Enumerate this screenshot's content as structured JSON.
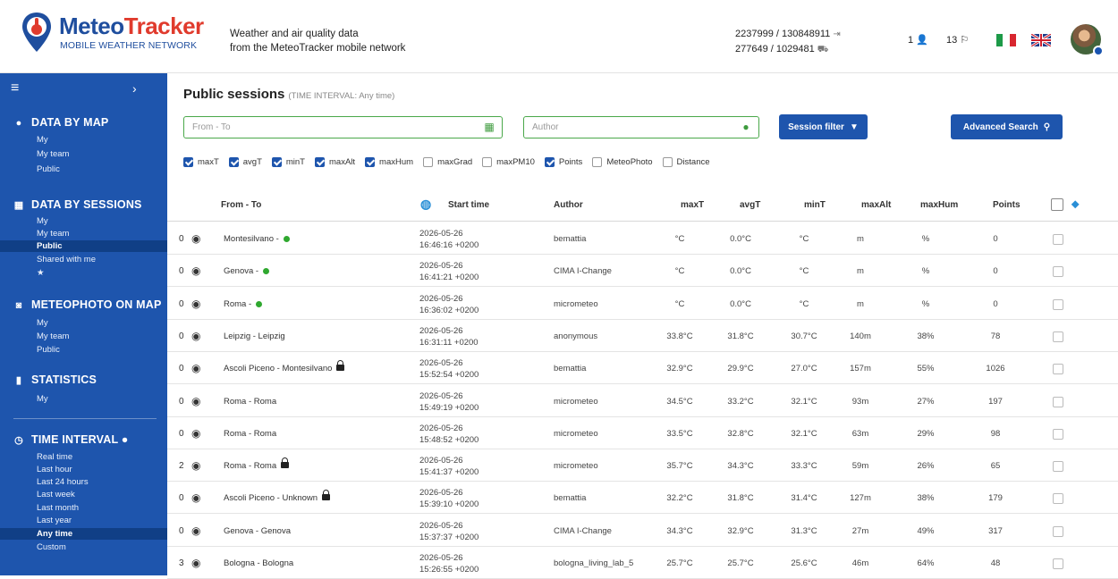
{
  "header": {
    "logo_title_a": "Meteo",
    "logo_title_b": "Tracker",
    "logo_subtitle": "MOBILE WEATHER NETWORK",
    "tagline_line1": "Weather and air quality data",
    "tagline_line2": "from the MeteoTracker mobile network",
    "stat_line1": "2237999 / 130848911",
    "stat_line2": "277649 / 1029481",
    "users_count": "1",
    "sessions_count": "13",
    "brand_color": "#1f4e9e",
    "accent_color": "#e03b2d"
  },
  "sidebar": {
    "background": "#1e55ad",
    "sections": {
      "data_by_map": "DATA BY MAP",
      "data_by_sessions": "DATA BY SESSIONS",
      "meteophoto_on_map": "METEOPHOTO ON MAP",
      "statistics": "STATISTICS",
      "time_interval": "TIME INTERVAL"
    },
    "map_items": [
      "My",
      "My team",
      "Public"
    ],
    "session_items": [
      "My",
      "My team",
      "Public",
      "Shared with me",
      "★"
    ],
    "photo_items": [
      "My",
      "My team",
      "Public"
    ],
    "stats_items": [
      "My"
    ],
    "time_items": [
      "Real time",
      "Last hour",
      "Last 24 hours",
      "Last week",
      "Last month",
      "Last year",
      "Any time",
      "Custom"
    ]
  },
  "main": {
    "title": "Public sessions",
    "subtitle": "(TIME INTERVAL: Any time)",
    "from_to_placeholder": "From - To",
    "author_placeholder": "Author",
    "session_filter_label": "Session filter",
    "advanced_search_label": "Advanced Search",
    "checkboxes": [
      {
        "label": "maxT",
        "checked": true
      },
      {
        "label": "avgT",
        "checked": true
      },
      {
        "label": "minT",
        "checked": true
      },
      {
        "label": "maxAlt",
        "checked": true
      },
      {
        "label": "maxHum",
        "checked": true
      },
      {
        "label": "maxGrad",
        "checked": false
      },
      {
        "label": "maxPM10",
        "checked": false
      },
      {
        "label": "Points",
        "checked": true
      },
      {
        "label": "MeteoPhoto",
        "checked": false
      },
      {
        "label": "Distance",
        "checked": false
      }
    ]
  },
  "table": {
    "headers": {
      "from_to": "From - To",
      "start_time": "Start time",
      "author": "Author",
      "maxT": "maxT",
      "avgT": "avgT",
      "minT": "minT",
      "maxAlt": "maxAlt",
      "maxHum": "maxHum",
      "points": "Points"
    },
    "rows": [
      {
        "count": "0",
        "from_to": "Montesilvano -",
        "live": true,
        "locked": false,
        "date": "2026-05-26",
        "time": "16:46:16 +0200",
        "author": "bemattia",
        "maxT": "°C",
        "avgT": "0.0°C",
        "minT": "°C",
        "maxAlt": "m",
        "maxHum": "%",
        "points": "0"
      },
      {
        "count": "0",
        "from_to": "Genova -",
        "live": true,
        "locked": false,
        "date": "2026-05-26",
        "time": "16:41:21 +0200",
        "author": "CIMA I-Change",
        "maxT": "°C",
        "avgT": "0.0°C",
        "minT": "°C",
        "maxAlt": "m",
        "maxHum": "%",
        "points": "0"
      },
      {
        "count": "0",
        "from_to": "Roma -",
        "live": true,
        "locked": false,
        "date": "2026-05-26",
        "time": "16:36:02 +0200",
        "author": "micrometeo",
        "maxT": "°C",
        "avgT": "0.0°C",
        "minT": "°C",
        "maxAlt": "m",
        "maxHum": "%",
        "points": "0"
      },
      {
        "count": "0",
        "from_to": "Leipzig - Leipzig",
        "live": false,
        "locked": false,
        "date": "2026-05-26",
        "time": "16:31:11 +0200",
        "author": "anonymous",
        "maxT": "33.8°C",
        "avgT": "31.8°C",
        "minT": "30.7°C",
        "maxAlt": "140m",
        "maxHum": "38%",
        "points": "78"
      },
      {
        "count": "0",
        "from_to": "Ascoli Piceno - Montesilvano",
        "live": false,
        "locked": true,
        "date": "2026-05-26",
        "time": "15:52:54 +0200",
        "author": "bemattia",
        "maxT": "32.9°C",
        "avgT": "29.9°C",
        "minT": "27.0°C",
        "maxAlt": "157m",
        "maxHum": "55%",
        "points": "1026"
      },
      {
        "count": "0",
        "from_to": "Roma - Roma",
        "live": false,
        "locked": false,
        "date": "2026-05-26",
        "time": "15:49:19 +0200",
        "author": "micrometeo",
        "maxT": "34.5°C",
        "avgT": "33.2°C",
        "minT": "32.1°C",
        "maxAlt": "93m",
        "maxHum": "27%",
        "points": "197"
      },
      {
        "count": "0",
        "from_to": "Roma - Roma",
        "live": false,
        "locked": false,
        "date": "2026-05-26",
        "time": "15:48:52 +0200",
        "author": "micrometeo",
        "maxT": "33.5°C",
        "avgT": "32.8°C",
        "minT": "32.1°C",
        "maxAlt": "63m",
        "maxHum": "29%",
        "points": "98"
      },
      {
        "count": "2",
        "from_to": "Roma - Roma",
        "live": false,
        "locked": true,
        "date": "2026-05-26",
        "time": "15:41:37 +0200",
        "author": "micrometeo",
        "maxT": "35.7°C",
        "avgT": "34.3°C",
        "minT": "33.3°C",
        "maxAlt": "59m",
        "maxHum": "26%",
        "points": "65"
      },
      {
        "count": "0",
        "from_to": "Ascoli Piceno - Unknown",
        "live": false,
        "locked": true,
        "date": "2026-05-26",
        "time": "15:39:10 +0200",
        "author": "bemattia",
        "maxT": "32.2°C",
        "avgT": "31.8°C",
        "minT": "31.4°C",
        "maxAlt": "127m",
        "maxHum": "38%",
        "points": "179"
      },
      {
        "count": "0",
        "from_to": "Genova - Genova",
        "live": false,
        "locked": false,
        "date": "2026-05-26",
        "time": "15:37:37 +0200",
        "author": "CIMA I-Change",
        "maxT": "34.3°C",
        "avgT": "32.9°C",
        "minT": "31.3°C",
        "maxAlt": "27m",
        "maxHum": "49%",
        "points": "317"
      },
      {
        "count": "3",
        "from_to": "Bologna - Bologna",
        "live": false,
        "locked": false,
        "date": "2026-05-26",
        "time": "15:26:55 +0200",
        "author": "bologna_living_lab_5",
        "maxT": "25.7°C",
        "avgT": "25.7°C",
        "minT": "25.6°C",
        "maxAlt": "46m",
        "maxHum": "64%",
        "points": "48"
      }
    ]
  }
}
